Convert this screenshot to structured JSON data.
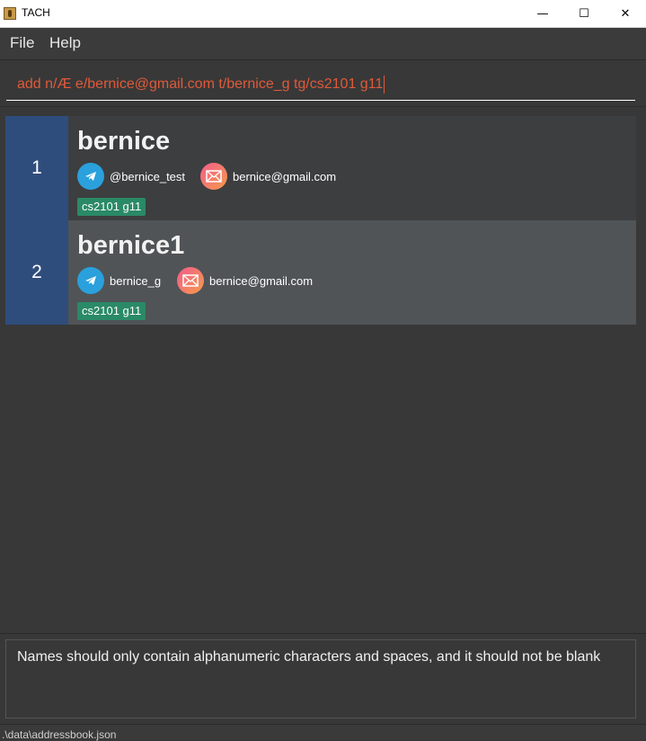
{
  "window": {
    "title": "TACH",
    "minimize_glyph": "—",
    "maximize_glyph": "☐",
    "close_glyph": "✕"
  },
  "menu": {
    "file": "File",
    "help": "Help"
  },
  "command": {
    "value": "add n/Æ e/bernice@gmail.com t/bernice_g tg/cs2101 g11",
    "text_color": "#e05a3a"
  },
  "persons": [
    {
      "index": "1",
      "name": "bernice",
      "telegram": "@bernice_test",
      "email": "bernice@gmail.com",
      "tag": "cs2101 g11"
    },
    {
      "index": "2",
      "name": "bernice1",
      "telegram": "bernice_g",
      "email": "bernice@gmail.com",
      "tag": "cs2101 g11"
    }
  ],
  "result": {
    "message": "Names should only contain alphanumeric characters and spaces, and it should not be blank"
  },
  "status": {
    "path": ".\\data\\addressbook.json"
  },
  "icons": {
    "telegram": "telegram-icon",
    "email": "email-icon"
  },
  "colors": {
    "index_bg": "#2f4d7c",
    "tag_bg": "#2a8a66",
    "telegram": "#2aa0dc"
  }
}
